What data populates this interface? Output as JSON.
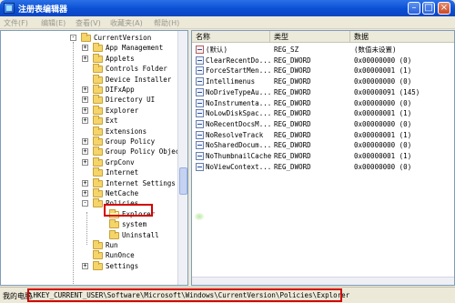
{
  "window": {
    "title": "注册表编辑器"
  },
  "menu": [
    "文件(F)",
    "编辑(E)",
    "查看(V)",
    "收藏夹(A)",
    "帮助(H)"
  ],
  "tree": {
    "items": [
      {
        "label": "CurrentVersion",
        "expander": "-",
        "level": 0
      },
      {
        "label": "App Management",
        "expander": "+",
        "level": 1
      },
      {
        "label": "Applets",
        "expander": "+",
        "level": 1
      },
      {
        "label": "Controls Folder",
        "expander": "",
        "level": 1
      },
      {
        "label": "Device Installer",
        "expander": "",
        "level": 1
      },
      {
        "label": "DIFxApp",
        "expander": "+",
        "level": 1
      },
      {
        "label": "Directory UI",
        "expander": "+",
        "level": 1
      },
      {
        "label": "Explorer",
        "expander": "+",
        "level": 1
      },
      {
        "label": "Ext",
        "expander": "+",
        "level": 1
      },
      {
        "label": "Extensions",
        "expander": "",
        "level": 1
      },
      {
        "label": "Group Policy",
        "expander": "+",
        "level": 1
      },
      {
        "label": "Group Policy Objec",
        "expander": "+",
        "level": 1
      },
      {
        "label": "GrpConv",
        "expander": "+",
        "level": 1
      },
      {
        "label": "Internet",
        "expander": "",
        "level": 1
      },
      {
        "label": "Internet Settings",
        "expander": "+",
        "level": 1
      },
      {
        "label": "NetCache",
        "expander": "+",
        "level": 1
      },
      {
        "label": "Policies",
        "expander": "-",
        "level": 1
      },
      {
        "label": "Explorer",
        "expander": "",
        "level": 2,
        "selected": true
      },
      {
        "label": "system",
        "expander": "",
        "level": 2
      },
      {
        "label": "Uninstall",
        "expander": "",
        "level": 2
      },
      {
        "label": "Run",
        "expander": "",
        "level": 1
      },
      {
        "label": "RunOnce",
        "expander": "",
        "level": 1
      },
      {
        "label": "Settings",
        "expander": "+",
        "level": 1
      }
    ]
  },
  "list": {
    "headers": {
      "name": "名称",
      "type": "类型",
      "data": "数据"
    },
    "rows": [
      {
        "name": "(默认)",
        "type": "REG_SZ",
        "data": "(数值未设置)",
        "icon": "sz"
      },
      {
        "name": "ClearRecentDo...",
        "type": "REG_DWORD",
        "data": "0x00000000 (0)",
        "icon": "dword"
      },
      {
        "name": "ForceStartMen...",
        "type": "REG_DWORD",
        "data": "0x00000001 (1)",
        "icon": "dword"
      },
      {
        "name": "Intellimenus",
        "type": "REG_DWORD",
        "data": "0x00000000 (0)",
        "icon": "dword"
      },
      {
        "name": "NoDriveTypeAu...",
        "type": "REG_DWORD",
        "data": "0x00000091 (145)",
        "icon": "dword"
      },
      {
        "name": "NoInstrumenta...",
        "type": "REG_DWORD",
        "data": "0x00000000 (0)",
        "icon": "dword"
      },
      {
        "name": "NoLowDiskSpac...",
        "type": "REG_DWORD",
        "data": "0x00000001 (1)",
        "icon": "dword"
      },
      {
        "name": "NoRecentDocsM...",
        "type": "REG_DWORD",
        "data": "0x00000000 (0)",
        "icon": "dword"
      },
      {
        "name": "NoResolveTrack",
        "type": "REG_DWORD",
        "data": "0x00000001 (1)",
        "icon": "dword"
      },
      {
        "name": "NoSharedDocum...",
        "type": "REG_DWORD",
        "data": "0x00000000 (0)",
        "icon": "dword"
      },
      {
        "name": "NoThumbnailCache",
        "type": "REG_DWORD",
        "data": "0x00000001 (1)",
        "icon": "dword"
      },
      {
        "name": "NoViewContext...",
        "type": "REG_DWORD",
        "data": "0x00000000 (0)",
        "icon": "dword"
      }
    ]
  },
  "status": {
    "label": "我的电脑",
    "path": "\\HKEY_CURRENT_USER\\Software\\Microsoft\\Windows\\CurrentVersion\\Policies\\Explorer"
  },
  "colors": {
    "highlight": "#d10000",
    "titlebar": "#0a4fd4"
  }
}
